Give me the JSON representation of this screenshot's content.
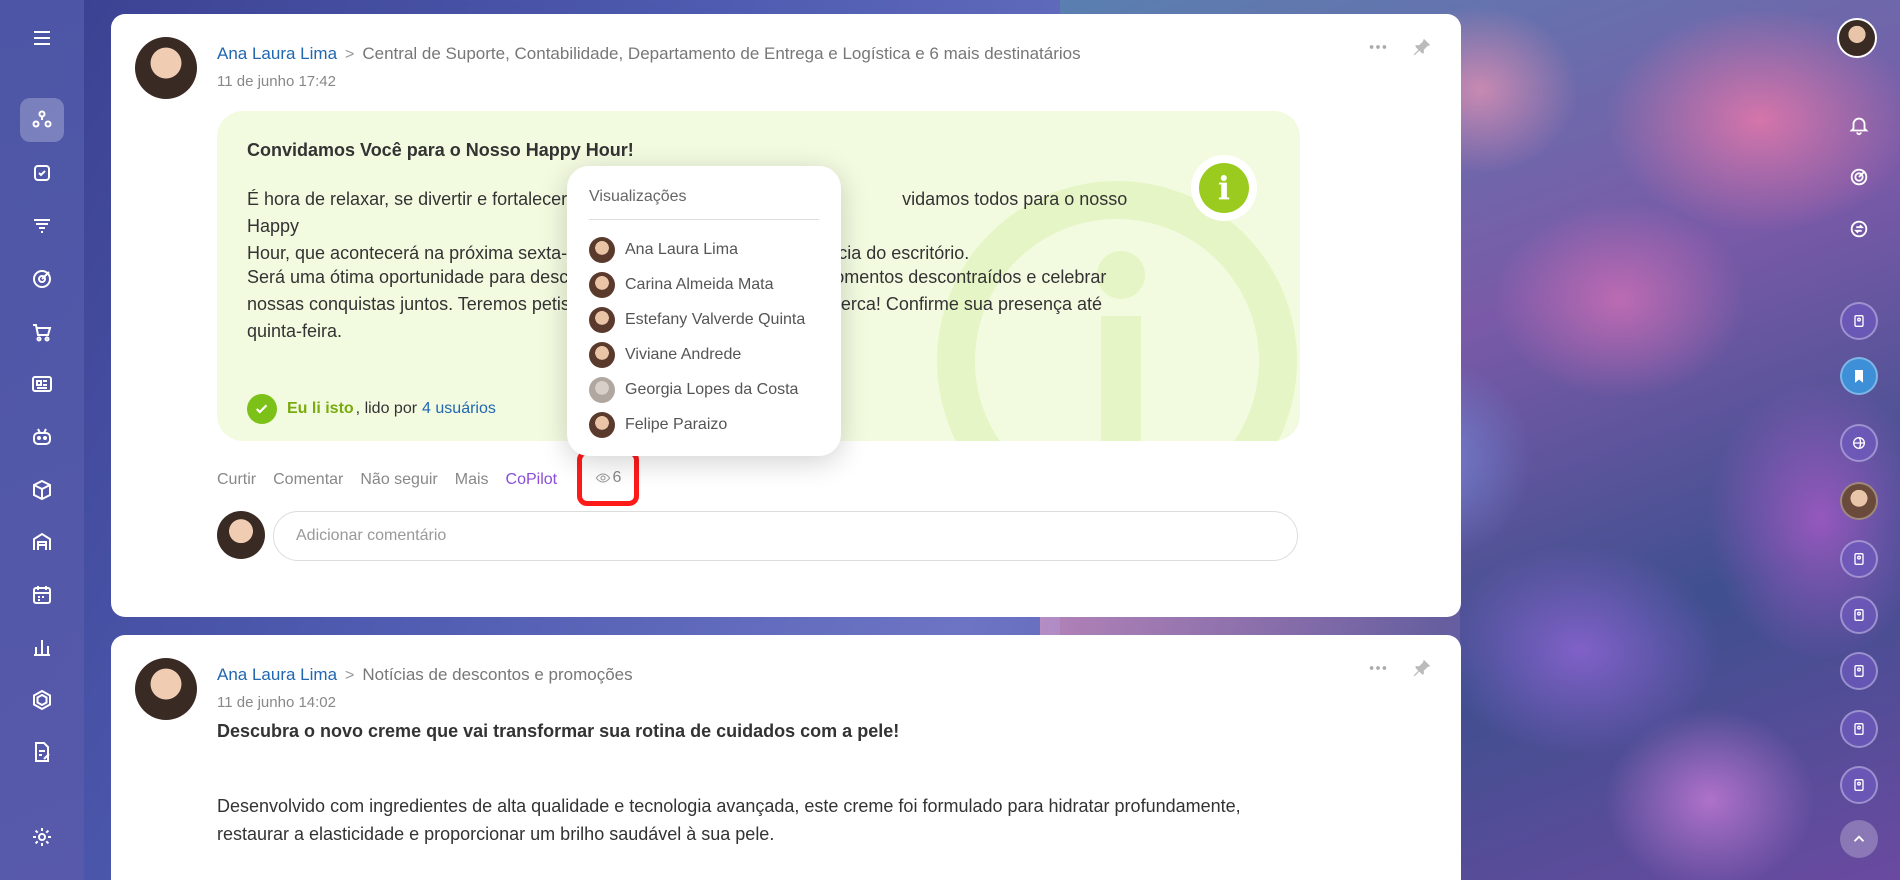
{
  "post1": {
    "author": "Ana Laura Lima",
    "destinations": "Central de Suporte, Contabilidade, Departamento de Entrega e Logística",
    "more_recipients": "e 6 mais destinatários",
    "date": "11 de junho 17:42",
    "title": "Convidamos Você para o Nosso Happy Hour!",
    "paragraph1": "É hora de relaxar, se divertir e fortalecer ... vidamos todos para o nosso Happy Hour, que acontecerá na próxima sexta-... ência do escritório.",
    "paragraph1_a": "É hora de relaxar, se divertir e fortalecer",
    "paragraph1_b": "vidamos todos para o nosso Happy",
    "paragraph1_c": "Hour, que acontecerá na próxima sexta-",
    "paragraph1_d": "ência do escritório.",
    "paragraph2_a": "Será uma ótima oportunidade para desc",
    "paragraph2_b": "momentos descontraídos e celebrar",
    "paragraph2_c": "nossas conquistas juntos. Teremos petisc",
    "paragraph2_d": "io perca! Confirme sua presença até",
    "paragraph2_e": "quinta-feira.",
    "read_me": "Eu li isto",
    "read_by": ", lido por",
    "read_users": "4 usuários",
    "actions": {
      "like": "Curtir",
      "comment": "Comentar",
      "unfollow": "Não seguir",
      "more": "Mais",
      "copilot": "CoPilot",
      "views": "6"
    },
    "comment_placeholder": "Adicionar comentário"
  },
  "views_popup": {
    "title": "Visualizações",
    "users": [
      "Ana Laura Lima",
      "Carina Almeida Mata",
      "Estefany Valverde Quinta",
      "Viviane Andrede",
      "Georgia Lopes da Costa",
      "Felipe Paraizo"
    ]
  },
  "post2": {
    "author": "Ana Laura Lima",
    "destination": "Notícias de descontos e promoções",
    "date": "11 de junho 14:02",
    "title": "Descubra o novo creme que vai transformar sua rotina de cuidados com a pele!",
    "body": "Desenvolvido com ingredientes de alta qualidade e tecnologia avançada, este creme foi formulado para hidratar profundamente, restaurar a elasticidade e proporcionar um brilho saudável à sua pele."
  },
  "colors": {
    "accent_blue": "#2067b0",
    "info_green": "#9ccb20",
    "highlight_red": "#ff1a1a",
    "copilot_purple": "#8a4ed6"
  },
  "icons": {
    "left_sidebar": [
      "menu-icon",
      "feed-icon",
      "tasks-icon",
      "funnel-icon",
      "target-icon",
      "cart-icon",
      "news-icon",
      "robot-icon",
      "box-icon",
      "warehouse-icon",
      "calendar-icon",
      "chart-icon",
      "hexagon-icon",
      "document-edit-icon",
      "settings-icon"
    ],
    "right_sidebar": [
      "user-avatar",
      "bell-icon",
      "pulse-icon",
      "chat-sync-icon",
      "contact-icon",
      "bookmark-icon",
      "globe-icon",
      "user-avatar-small",
      "contact-icon",
      "contact-icon",
      "contact-icon",
      "contact-icon",
      "contact-icon",
      "scroll-up-icon"
    ]
  }
}
